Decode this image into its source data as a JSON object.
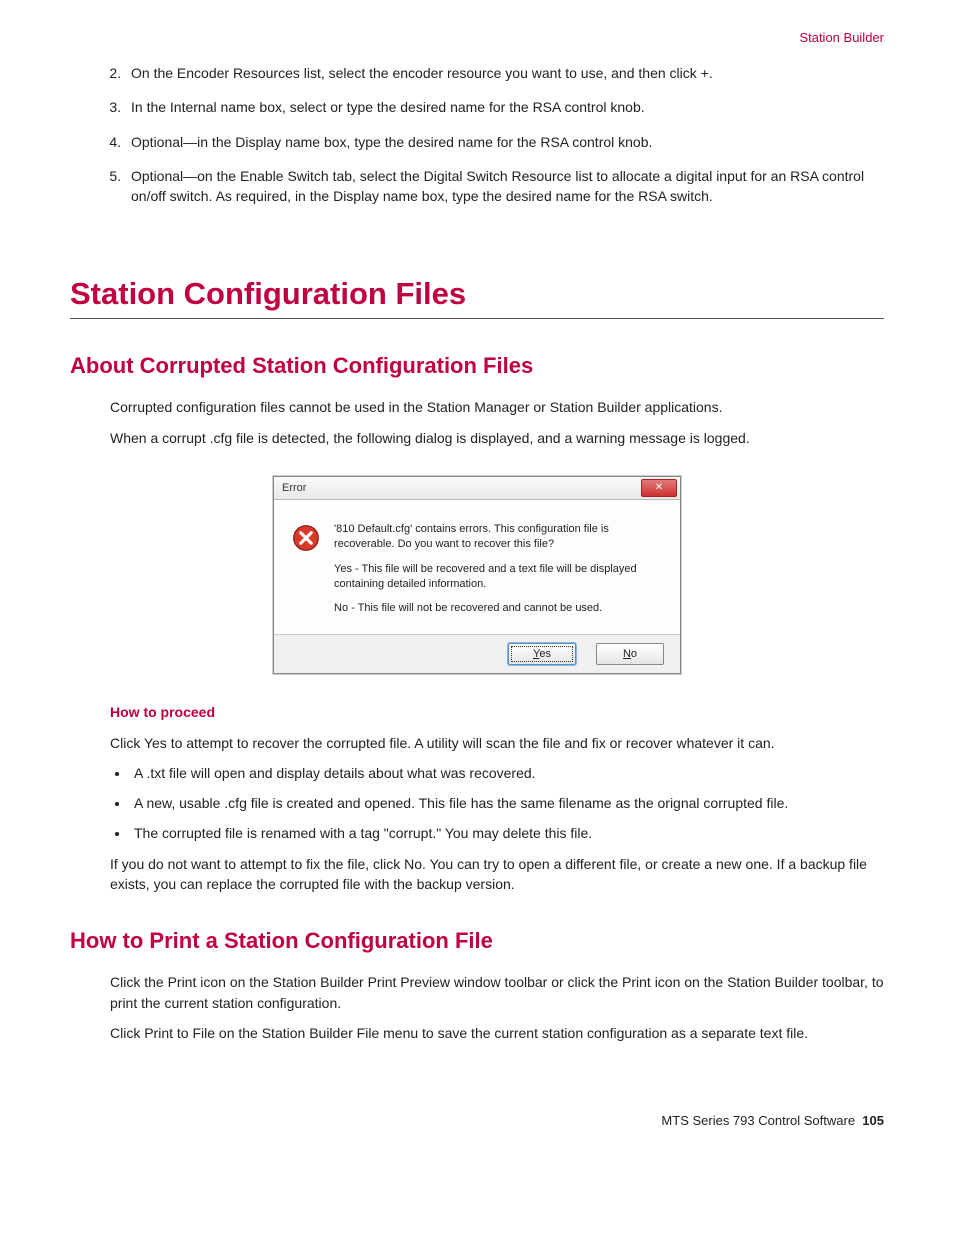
{
  "header": {
    "breadcrumb": "Station Builder"
  },
  "steps": [
    {
      "n": "2.",
      "text": "On the Encoder Resources list, select the encoder resource you want to use, and then click +."
    },
    {
      "n": "3.",
      "text": "In the Internal name box, select or type the desired name for the RSA control knob."
    },
    {
      "n": "4.",
      "text": "Optional—in the Display name box, type the desired name for the RSA control knob."
    },
    {
      "n": "5.",
      "text": "Optional—on the Enable Switch tab, select the Digital Switch Resource list to allocate a digital input for an RSA control on/off switch. As required, in the Display name box, type the desired name for the RSA switch."
    }
  ],
  "h1": "Station Configuration Files",
  "section_about": {
    "title": "About Corrupted Station Configuration Files",
    "p1": "Corrupted configuration files cannot be used in the Station Manager or Station Builder applications.",
    "p2": "When a corrupt .cfg file is detected, the following dialog is displayed, and a warning message is logged."
  },
  "dialog": {
    "title": "Error",
    "close": "✕",
    "msg_main": "'810 Default.cfg' contains errors. This configuration file is recoverable. Do you want to recover this file?",
    "msg_yes": "Yes - This file will be recovered and a text file will be displayed containing detailed information.",
    "msg_no": "No  - This file will not be recovered and cannot be used.",
    "btn_yes": "Yes",
    "btn_no": "No"
  },
  "proceed": {
    "heading": "How to proceed",
    "p1": "Click Yes to attempt to recover the corrupted file. A utility will scan the file and fix or recover whatever it can.",
    "bullets": [
      "A .txt file will open and display details about what was recovered.",
      "A new, usable .cfg file is created and opened. This file has the same filename as the orignal corrupted file.",
      "The corrupted file is renamed with a tag \"corrupt.\" You may delete this file."
    ],
    "p2": "If you do not want to attempt to fix the file, click No. You can try to open a different file, or create a new one. If a backup file exists, you can replace the corrupted file with the backup version."
  },
  "section_print": {
    "title": "How to Print a Station Configuration File",
    "p1": "Click the Print icon on the Station Builder Print Preview window toolbar or click the Print icon on the Station Builder toolbar, to print the current station configuration.",
    "p2": "Click Print to File on the Station Builder File menu to save the current station configuration as a separate text file."
  },
  "footer": {
    "product": "MTS Series 793 Control Software",
    "page": "105"
  }
}
